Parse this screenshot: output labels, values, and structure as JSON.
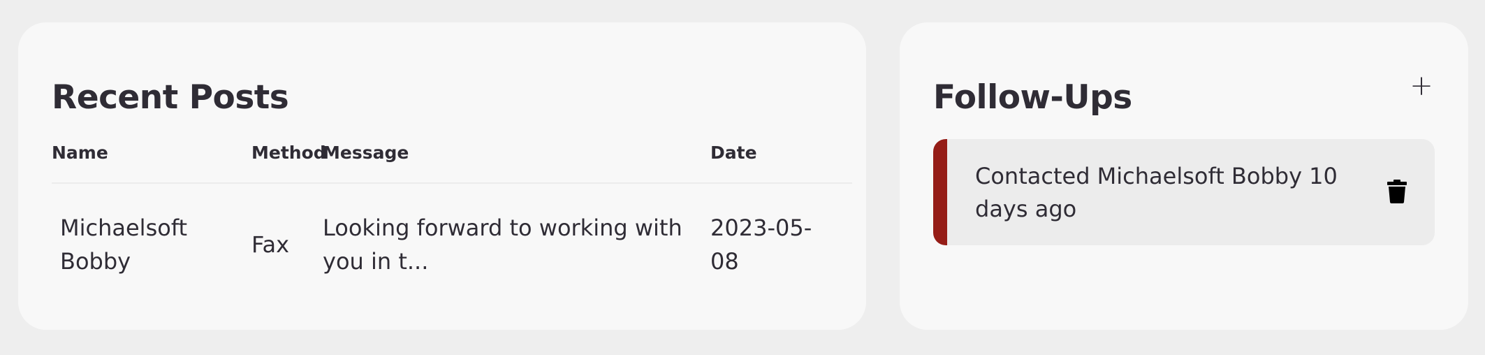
{
  "recent_posts": {
    "title": "Recent Posts",
    "columns": {
      "name": "Name",
      "method": "Method",
      "message": "Message",
      "date": "Date"
    },
    "rows": [
      {
        "name": "Michaelsoft Bobby",
        "method": "Fax",
        "message": "Looking forward to working with you in t...",
        "date": "2023-05-08"
      }
    ]
  },
  "follow_ups": {
    "title": "Follow-Ups",
    "add_label": "+",
    "add_icon": "plus-icon",
    "items": [
      {
        "text": "Contacted Michaelsoft Bobby 10 days ago",
        "accent_color": "#951d17",
        "delete_icon": "trash-icon"
      }
    ]
  }
}
